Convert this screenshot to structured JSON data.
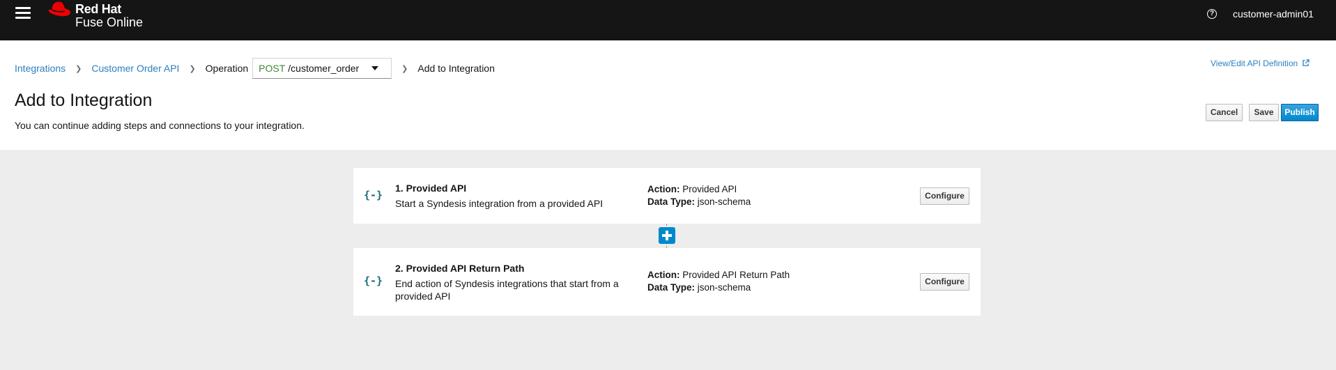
{
  "masthead": {
    "brand_line1": "Red Hat",
    "brand_line2": "Fuse Online",
    "help_icon_glyph": "?",
    "username": "customer-admin01"
  },
  "breadcrumb": {
    "integrations": "Integrations",
    "api_name": "Customer Order API",
    "operation_label": "Operation",
    "operation_method": "POST",
    "operation_path": "/customer_order",
    "current": "Add to Integration"
  },
  "header": {
    "api_definition_link": "View/Edit API Definition",
    "title": "Add to Integration",
    "subtitle": "You can continue adding steps and connections to your integration.",
    "cancel_label": "Cancel",
    "save_label": "Save",
    "publish_label": "Publish"
  },
  "steps": [
    {
      "icon": "{-}",
      "title": "1. Provided API",
      "description": "Start a Syndesis integration from a provided API",
      "action_key": "Action:",
      "action_value": "Provided API",
      "datatype_key": "Data Type:",
      "datatype_value": "json-schema",
      "configure_label": "Configure"
    },
    {
      "icon": "{-}",
      "title": "2. Provided API Return Path",
      "description": "End action of Syndesis integrations that start from a provided API",
      "action_key": "Action:",
      "action_value": "Provided API Return Path",
      "datatype_key": "Data Type:",
      "datatype_value": "json-schema",
      "configure_label": "Configure"
    }
  ],
  "colors": {
    "masthead_bg": "#151515",
    "link": "#2b7fbf",
    "primary": "#0088ce",
    "method_post": "#3e8635",
    "step_icon": "#1c6b7a"
  }
}
